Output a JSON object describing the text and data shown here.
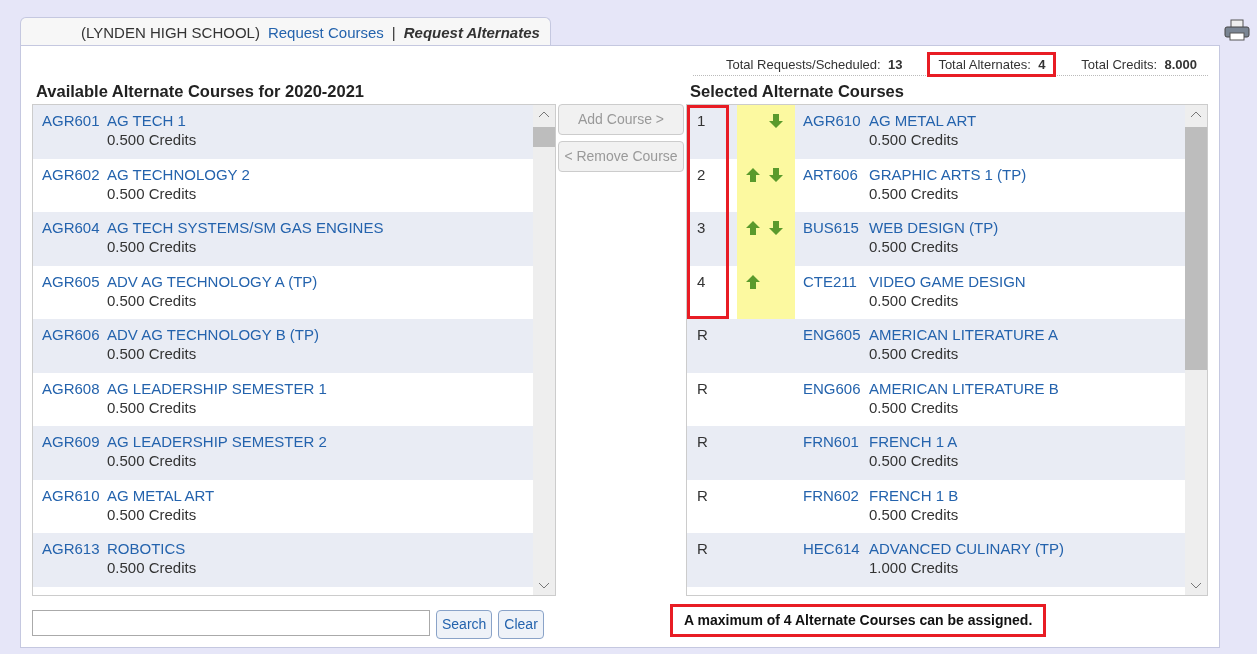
{
  "tab": {
    "school": "(LYNDEN HIGH SCHOOL)",
    "links": [
      {
        "label": "Request Courses",
        "selected": false
      },
      {
        "label": "Request Alternates",
        "selected": true
      }
    ],
    "separator": "|"
  },
  "stats": [
    {
      "label": "Total Requests/Scheduled:",
      "value": "13",
      "highlighted": false
    },
    {
      "label": "Total Alternates:",
      "value": "4",
      "highlighted": true
    },
    {
      "label": "Total Credits:",
      "value": "8.000",
      "highlighted": false
    }
  ],
  "available": {
    "title": "Available Alternate Courses for 2020-2021",
    "courses": [
      {
        "code": "AGR601",
        "name": "AG TECH 1",
        "credits": "0.500 Credits"
      },
      {
        "code": "AGR602",
        "name": "AG TECHNOLOGY 2",
        "credits": "0.500 Credits"
      },
      {
        "code": "AGR604",
        "name": "AG TECH SYSTEMS/SM GAS ENGINES",
        "credits": "0.500 Credits"
      },
      {
        "code": "AGR605",
        "name": "ADV AG TECHNOLOGY A (TP)",
        "credits": "0.500 Credits"
      },
      {
        "code": "AGR606",
        "name": "ADV AG TECHNOLOGY B (TP)",
        "credits": "0.500 Credits"
      },
      {
        "code": "AGR608",
        "name": "AG LEADERSHIP SEMESTER 1",
        "credits": "0.500 Credits"
      },
      {
        "code": "AGR609",
        "name": "AG LEADERSHIP SEMESTER 2",
        "credits": "0.500 Credits"
      },
      {
        "code": "AGR610",
        "name": "AG METAL ART",
        "credits": "0.500 Credits"
      },
      {
        "code": "AGR613",
        "name": "ROBOTICS",
        "credits": "0.500 Credits"
      }
    ]
  },
  "actions": [
    {
      "label": "Add Course >",
      "disabled": true
    },
    {
      "label": "< Remove Course",
      "disabled": true
    }
  ],
  "selected": {
    "title": "Selected Alternate Courses",
    "rank_highlighted": true,
    "courses": [
      {
        "rank": "1",
        "ranked": true,
        "up": false,
        "down": true,
        "code": "AGR610",
        "name": "AG METAL ART",
        "credits": "0.500 Credits"
      },
      {
        "rank": "2",
        "ranked": true,
        "up": true,
        "down": true,
        "code": "ART606",
        "name": "GRAPHIC ARTS 1 (TP)",
        "credits": "0.500 Credits"
      },
      {
        "rank": "3",
        "ranked": true,
        "up": true,
        "down": true,
        "code": "BUS615",
        "name": "WEB DESIGN (TP)",
        "credits": "0.500 Credits"
      },
      {
        "rank": "4",
        "ranked": true,
        "up": true,
        "down": false,
        "code": "CTE211",
        "name": "VIDEO GAME DESIGN",
        "credits": "0.500 Credits"
      },
      {
        "rank": "R",
        "ranked": false,
        "up": false,
        "down": false,
        "code": "ENG605",
        "name": "AMERICAN LITERATURE A",
        "credits": "0.500 Credits"
      },
      {
        "rank": "R",
        "ranked": false,
        "up": false,
        "down": false,
        "code": "ENG606",
        "name": "AMERICAN LITERATURE B",
        "credits": "0.500 Credits"
      },
      {
        "rank": "R",
        "ranked": false,
        "up": false,
        "down": false,
        "code": "FRN601",
        "name": "FRENCH 1 A",
        "credits": "0.500 Credits"
      },
      {
        "rank": "R",
        "ranked": false,
        "up": false,
        "down": false,
        "code": "FRN602",
        "name": "FRENCH 1 B",
        "credits": "0.500 Credits"
      },
      {
        "rank": "R",
        "ranked": false,
        "up": false,
        "down": false,
        "code": "HEC614",
        "name": "ADVANCED CULINARY (TP)",
        "credits": "1.000 Credits"
      }
    ]
  },
  "search_buttons": [
    "Search",
    "Clear"
  ],
  "message": {
    "text": "A maximum of 4 Alternate Courses can be assigned.",
    "highlighted": true
  }
}
